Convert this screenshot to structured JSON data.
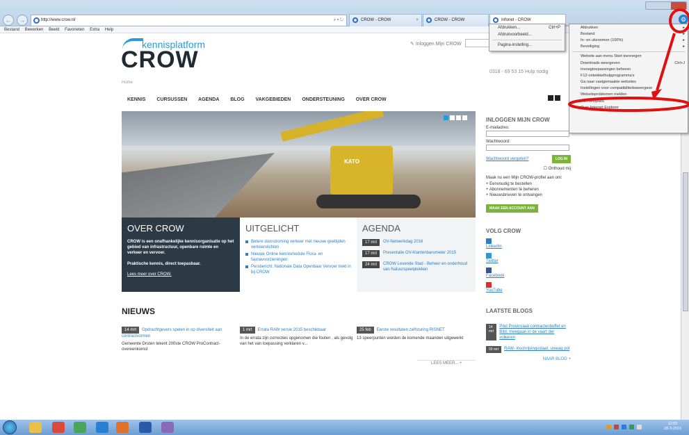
{
  "browser": {
    "url": "http://www.crow.nl/",
    "addr_tools": "⌕ ▾ ↻",
    "tabs": [
      {
        "label": "CROW - CROW"
      },
      {
        "label": "CROW - CROW"
      },
      {
        "label": "Infonet - CROW"
      }
    ],
    "menubar": [
      "Bestand",
      "Bewerken",
      "Beeld",
      "Favorieten",
      "Extra",
      "Help"
    ]
  },
  "print_menu": {
    "items": [
      {
        "label": "Afdrukken...",
        "shortcut": "Ctrl+P"
      },
      {
        "label": "Afdrukvoorbeeld...",
        "shortcut": ""
      },
      {
        "label": "Pagina-instelling...",
        "shortcut": ""
      }
    ]
  },
  "tools_menu": {
    "items": [
      {
        "label": "Afdrukken",
        "arrow": "▸",
        "sc": ""
      },
      {
        "label": "Bestand",
        "arrow": "▸",
        "sc": ""
      },
      {
        "label": "In- en uitzoomen (100%)",
        "arrow": "▸",
        "sc": ""
      },
      {
        "label": "Beveiliging",
        "arrow": "▸",
        "sc": ""
      },
      {
        "label": "Website aan menu Start toevoegen",
        "arrow": "",
        "sc": ""
      },
      {
        "label": "Downloads weergeven",
        "arrow": "",
        "sc": "Ctrl+J"
      },
      {
        "label": "Invoegtoepassingen beheren",
        "arrow": "",
        "sc": ""
      },
      {
        "label": "F12-ontwikkelhulpprogramma's",
        "arrow": "",
        "sc": ""
      },
      {
        "label": "Ga naar vastgemaakte websites",
        "arrow": "",
        "sc": ""
      },
      {
        "label": "Instellingen voor compatibiliteitsweergave",
        "arrow": "",
        "sc": ""
      },
      {
        "label": "Websiteproblemen melden",
        "arrow": "",
        "sc": ""
      },
      {
        "label": "Internetopties",
        "arrow": "",
        "sc": ""
      },
      {
        "label": "Over Internet Explorer",
        "arrow": "",
        "sc": ""
      }
    ]
  },
  "site": {
    "logo_top": "kennisplatform",
    "logo_main": "CROW",
    "login_link": "Inloggen Mijn CROW",
    "phone": "0318 - 69 53 15   Hulp nodig",
    "breadcrumb": "Home",
    "nav": [
      "KENNIS",
      "CURSUSSEN",
      "AGENDA",
      "BLOG",
      "VAKGEBIEDEN",
      "ONDERSTEUNING",
      "OVER CROW"
    ],
    "hero_brand": "KATO",
    "over": {
      "title": "OVER CROW",
      "p1": "CROW is een onafhankelijke kennisorganisatie op het gebied van infrastructuur, openbare ruimte en verkeer en vervoer.",
      "p2": "Praktische kennis, direct toepasbaar.",
      "link": "Lees meer over CROW."
    },
    "uitgelicht": {
      "title": "UITGELICHT",
      "items": [
        "Betere doorstroming verkeer met nieuwe geeltijden verkeerslichten",
        "Nieuwe Online kennismodule Flora- en faunavoorzieningen",
        "Persbericht: Nationale Data Openbaar Vervoer trekt in bij CROW"
      ]
    },
    "agenda": {
      "title": "AGENDA",
      "items": [
        {
          "date": "17 mrt",
          "title": "OV-Netwerkdag 2016"
        },
        {
          "date": "17 mrt",
          "title": "Presentatie OV-Klantenbarometer 2015"
        },
        {
          "date": "24 mrt",
          "title": "CROW Levende Stad - Beheer en onderhoud van Natuurspeelplekken"
        }
      ]
    },
    "nieuws": {
      "title": "NIEUWS",
      "items": [
        {
          "date": "14 mrt",
          "title": "Opdrachtgevers spelen in op diversiteit aan contractvormen",
          "desc": "Gemeente Druten tekent 200ste CROW ProContract-overeenkomst"
        },
        {
          "date": "1 mrt",
          "title": "Errata RAW versie 2015 beschikbaar",
          "desc": "In de errata zijn correcties opgenomen die fouten , als gevolg van het van toepassing verklaren v..."
        },
        {
          "date": "25 feb",
          "title": "Eerste resultaten zelfsturing RISNET",
          "desc": "13 speerpunten worden de komende maanden uitgewerkt"
        }
      ],
      "more": "LEES MEER...  +"
    },
    "sidebar": {
      "login_title": "INLOGGEN MIJN CROW",
      "email_label": "E-mailadres:",
      "password_label": "Wachtwoord:",
      "forgot": "Wachtwoord vergeten?",
      "login_btn": "LOG IN",
      "remember": "Onthoud mij",
      "profile_text": "Maak nu een Mijn CROW-profiel aan om:",
      "benefits": [
        "+ Eenvoudig te bestellen",
        "+ Abonnementen te beheren",
        "+ Nieuwsbrieven te ontvangen"
      ],
      "create_btn": "MAAK EEN ACCOUNT AAN",
      "volg_title": "VOLG CROW",
      "socials": [
        "LinkedIn",
        "Twitter",
        "Facebook",
        "YouTube"
      ],
      "blogs_title": "LAATSTE BLOGS",
      "blogs": [
        {
          "date": "14 mrt",
          "title": "Pilot Provinciaal contractenbuffet en BIM, meegaan in de vaart der volkeren"
        },
        {
          "date": "09 mrt",
          "title": "RAW- inschrijvingsstaat, unieag pol"
        }
      ],
      "blogs_more": "NAAR BLOG  +"
    }
  },
  "taskbar": {
    "time": "12:55",
    "date": "28-3-2016"
  },
  "colors": {
    "accent": "#2a9bd6",
    "dark": "#2b3a45",
    "green": "#7bb43a",
    "annotation": "#e01010"
  }
}
